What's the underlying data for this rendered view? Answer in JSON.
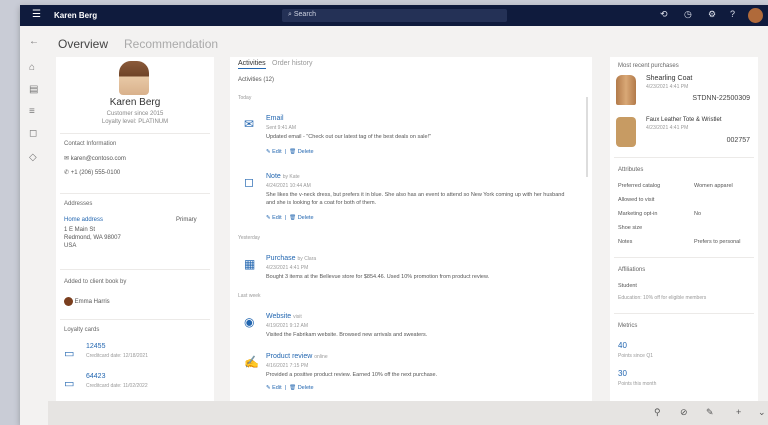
{
  "topbar": {
    "user": "Karen Berg",
    "search_placeholder": "Search"
  },
  "header": {
    "overview": "Overview",
    "recommendation": "Recommendation"
  },
  "contact": {
    "name": "Karen Berg",
    "sub1": "Customer since 2015",
    "sub2": "Loyalty level: PLATINUM",
    "contact_info_title": "Contact Information",
    "email": "karen@contoso.com",
    "phone": "+1 (206) 555-0100",
    "addresses_title": "Addresses",
    "home_address_label": "Home address",
    "home_address_tag": "Primary",
    "addr_line1": "1 E Main St",
    "addr_line2": "Redmond, WA 98007",
    "addr_line3": "USA",
    "added_by_title": "Added to client book by",
    "added_by_name": "Emma Harris",
    "loyalty_cards_title": "Loyalty cards",
    "card1_num": "12455",
    "card1_exp": "Creditcard date: 12/18/2021",
    "card2_num": "64423",
    "card2_exp": "Creditcard date: 11/02/2022"
  },
  "timeline": {
    "tab_activities": "Activities",
    "tab_order_history": "Order history",
    "title": "Activities (12)",
    "group_today": "Today",
    "group_yesterday": "Yesterday",
    "group_last_week": "Last week",
    "items": [
      {
        "icon": "email-icon",
        "title": "Email",
        "meta": "Sent 9:41 AM",
        "desc": "Updated email - \"Check out our latest tag of the best deals on sale!\"",
        "edit": "Edit",
        "delete": "Delete"
      },
      {
        "icon": "note-icon",
        "title": "Note",
        "by": "by Kate",
        "meta": "4/24/2021 10:44 AM",
        "desc": "She likes the v-neck dress, but prefers it in blue. She also has an event to attend so New York coming up with her husband and she is looking for a coat for both of them.",
        "edit": "Edit",
        "delete": "Delete"
      },
      {
        "icon": "purchase-icon",
        "title": "Purchase",
        "by": "by Clara",
        "meta": "4/23/2021 4:41 PM",
        "desc": "Bought 3 items at the Bellevue store for $854.46. Used 10% promotion from product review."
      },
      {
        "icon": "website-icon",
        "title": "Website",
        "by": "visit",
        "meta": "4/19/2021 9:12 AM",
        "desc": "Visited the Fabrikam website. Browsed new arrivals and sweaters."
      },
      {
        "icon": "review-icon",
        "title": "Product review",
        "by": "online",
        "meta": "4/16/2021 7:15 PM",
        "desc": "Provided a positive product review. Earned 10% off the next purchase.",
        "edit": "Edit",
        "delete": "Delete"
      }
    ]
  },
  "purchases": {
    "title": "Most recent purchases",
    "items": [
      {
        "name": "Shearling Coat",
        "date": "4/23/2021 4:41 PM",
        "number": "STDNN-22500309"
      },
      {
        "name": "Faux Leather Tote & Wristlet",
        "date": "4/23/2021 4:41 PM",
        "number": "002757"
      }
    ]
  },
  "attributes": {
    "title": "Attributes",
    "rows": [
      {
        "key": "Preferred catalog",
        "value": "Women apparel"
      },
      {
        "key": "Allowed to visit",
        "value": ""
      },
      {
        "key": "Marketing opt-in",
        "value": "No"
      },
      {
        "key": "Shoe size",
        "value": ""
      },
      {
        "key": "Notes",
        "value": "Prefers to personal"
      }
    ]
  },
  "affiliations": {
    "title": "Affiliations",
    "student": "Student",
    "student_desc": "Education: 10% off for eligible members"
  },
  "metrics": {
    "title": "Metrics",
    "stat1_value": "40",
    "stat1_label": "Points since Q1",
    "stat2_value": "30",
    "stat2_label": "Points this month"
  }
}
